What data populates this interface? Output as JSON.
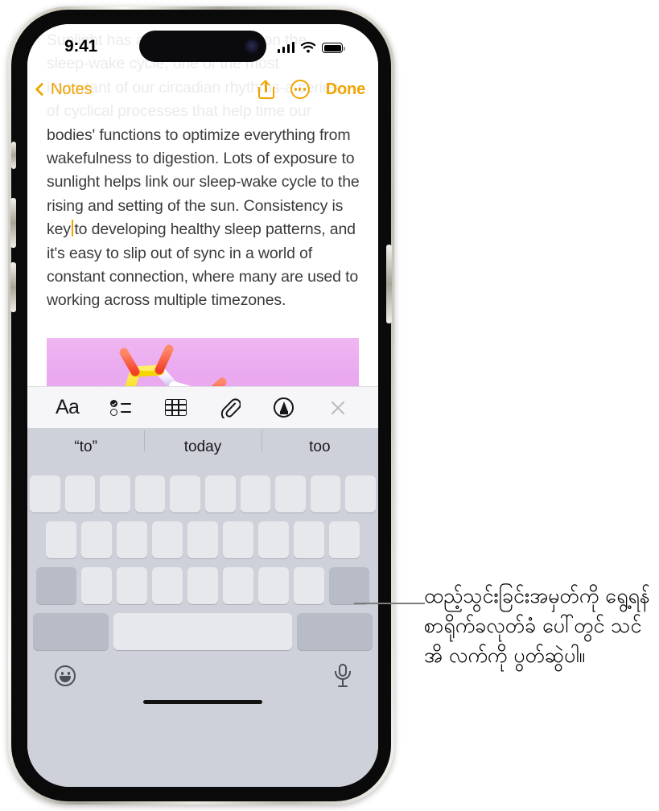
{
  "statusbar": {
    "time": "9:41",
    "cellular_icon": "signal-bars-icon",
    "wifi_icon": "wifi-icon",
    "battery_icon": "battery-icon"
  },
  "navbar": {
    "back_label": "Notes",
    "back_icon": "chevron-left-icon",
    "share_icon": "share-icon",
    "more_icon": "more-circle-icon",
    "done_label": "Done"
  },
  "note": {
    "faded_line_1": "Sunlight has a profound impact on the",
    "faded_line_2": "sleep-wake cycle, one of the most",
    "faded_line_3": "important of our circadian rhythms-a series",
    "faded_line_4": "of cyclical processes that help time our",
    "text_before_cursor": "bodies' functions to optimize everything from wakefulness to digestion. Lots of exposure to sunlight helps link our sleep-wake cycle to the rising and setting of the sun. Consistency is key",
    "text_after_cursor": "to developing healthy sleep patterns, and it's easy to slip out of sync in a world of constant connection, where many are used to working across multiple timezones.",
    "cursor_color": "#f0a500",
    "attachment_alt": "molecule-illustration"
  },
  "format_toolbar": {
    "items": [
      {
        "name": "format-aa-button",
        "label": "Aa"
      },
      {
        "name": "checklist-button",
        "label": ""
      },
      {
        "name": "table-button",
        "label": ""
      },
      {
        "name": "attachment-button",
        "label": ""
      },
      {
        "name": "markup-button",
        "label": ""
      },
      {
        "name": "close-toolbar-button",
        "label": ""
      }
    ]
  },
  "keyboard": {
    "predictions": [
      "“to”",
      "today",
      "too"
    ],
    "row1_count": 10,
    "row2_count": 9,
    "row3_count": 7,
    "shift_key": "shift-key",
    "delete_key": "delete-key",
    "numbers_key": "numbers-key",
    "space_key": "space-key",
    "return_key": "return-key",
    "emoji_icon": "emoji-icon",
    "dictation_icon": "microphone-icon"
  },
  "callout": {
    "text": "ထည့်သွင်းခြင်းအမှတ်ကို ရွေ့ရန် စာရိုက်ခလုတ်ခံ ပေါ်တွင် သင်အိ လက်ကို ပွတ်ဆွဲပါ။",
    "leader_color": "#7d7d7d"
  }
}
